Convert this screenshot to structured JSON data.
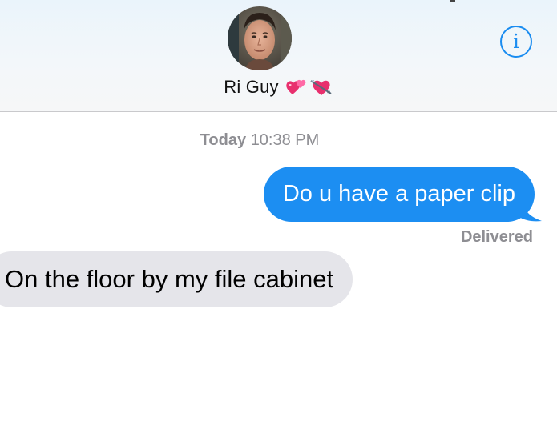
{
  "header": {
    "contact_name": "Ri Guy",
    "contact_emojis": [
      "💞",
      "💘"
    ],
    "info_icon": "info-icon",
    "info_glyph": "i",
    "accent_color": "#1a8cf0"
  },
  "conversation": {
    "timestamp_day": "Today",
    "timestamp_time": "10:38 PM",
    "messages": [
      {
        "direction": "sent",
        "text": "Do u have a paper clip",
        "bubble_color": "#1c8ef2"
      },
      {
        "direction": "received",
        "text": "On the floor by my file cabinet",
        "bubble_color": "#e5e5ea"
      }
    ],
    "delivery_status": "Delivered"
  }
}
